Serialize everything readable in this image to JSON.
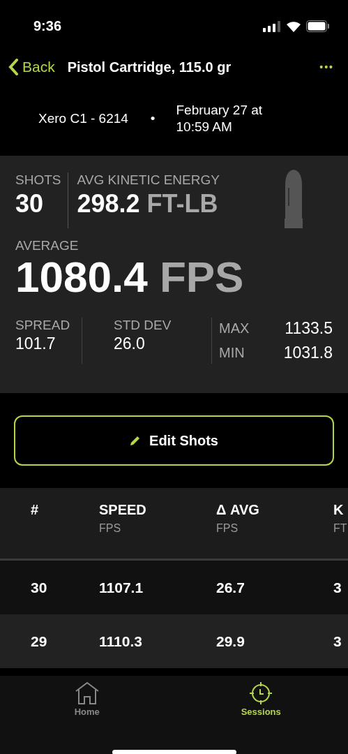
{
  "status_bar": {
    "time": "9:36"
  },
  "nav": {
    "back": "Back",
    "title": "Pistol Cartridge, 115.0 gr",
    "more": "•••"
  },
  "session": {
    "device": "Xero C1 - 6214",
    "separator": "•",
    "date": "February 27 at 10:59 AM"
  },
  "summary": {
    "shots_label": "SHOTS",
    "shots": "30",
    "energy_label": "AVG KINETIC ENERGY",
    "energy": "298.2",
    "energy_unit": "FT-LB",
    "average_label": "AVERAGE",
    "average": "1080.4",
    "average_unit": "FPS",
    "stats": [
      {
        "label": "SPREAD",
        "value": "101.7"
      },
      {
        "label": "STD DEV",
        "value": "26.0"
      }
    ],
    "extremes": [
      {
        "label": "MAX",
        "value": "1133.5"
      },
      {
        "label": "MIN",
        "value": "1031.8"
      }
    ]
  },
  "edit_button": "Edit Shots",
  "table": {
    "columns": [
      {
        "label": "#"
      },
      {
        "label": "SPEED",
        "unit": "FPS"
      },
      {
        "label": "Δ AVG",
        "unit": "FPS"
      },
      {
        "label": "K",
        "unit": "FT"
      }
    ],
    "rows": [
      [
        "30",
        "1107.1",
        "26.7",
        "3"
      ],
      [
        "29",
        "1110.3",
        "29.9",
        "3"
      ]
    ]
  },
  "tab_bar": [
    {
      "label": "Home",
      "kind": "home",
      "selected": false
    },
    {
      "label": "Sessions",
      "kind": "target",
      "selected": true
    }
  ]
}
